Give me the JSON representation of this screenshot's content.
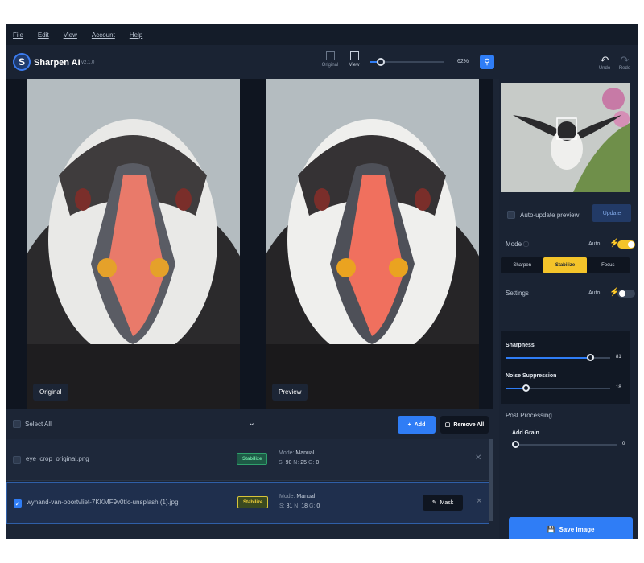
{
  "menu": [
    "File",
    "Edit",
    "View",
    "Account",
    "Help"
  ],
  "app": {
    "name": "Sharpen AI",
    "version": "v2.1.0",
    "logo_letter": "S"
  },
  "toolbar": {
    "original_label": "Original",
    "view_label": "View",
    "zoom_value": "62%",
    "zoom_fraction": 0.14,
    "undo_label": "Undo",
    "redo_label": "Redo"
  },
  "preview": {
    "left_label": "Original",
    "right_label": "Preview"
  },
  "file_bar": {
    "select_all": "Select All",
    "add_label": "Add",
    "remove_all_label": "Remove All"
  },
  "files": [
    {
      "name": "eye_crop_original.png",
      "mode": "Stabilize",
      "mode_label": "Mode:",
      "mode_value": "Manual",
      "s": "90",
      "n": "25",
      "g": "0",
      "checked": false
    },
    {
      "name": "wynand-van-poortvliet-7KKMF9v0tIc-unsplash (1).jpg",
      "mode": "Stabilize",
      "mode_label": "Mode:",
      "mode_value": "Manual",
      "s": "81",
      "n": "18",
      "g": "0",
      "checked": true,
      "mask_label": "Mask"
    }
  ],
  "panel": {
    "auto_update": "Auto-update preview",
    "update_label": "Update",
    "mode_label": "Mode",
    "auto_label": "Auto",
    "modes": [
      "Sharpen",
      "Stabilize",
      "Focus"
    ],
    "settings_label": "Settings",
    "settings_auto": "Auto",
    "sharpness_label": "Sharpness",
    "sharpness_value": "81",
    "noise_label": "Noise Suppression",
    "noise_value": "18",
    "post_label": "Post Processing",
    "grain_label": "Add Grain",
    "grain_value": "0",
    "save_label": "Save Image"
  },
  "colors": {
    "accent": "#2f7df6",
    "mode_active": "#f4c42a",
    "background": "#1c2535"
  }
}
